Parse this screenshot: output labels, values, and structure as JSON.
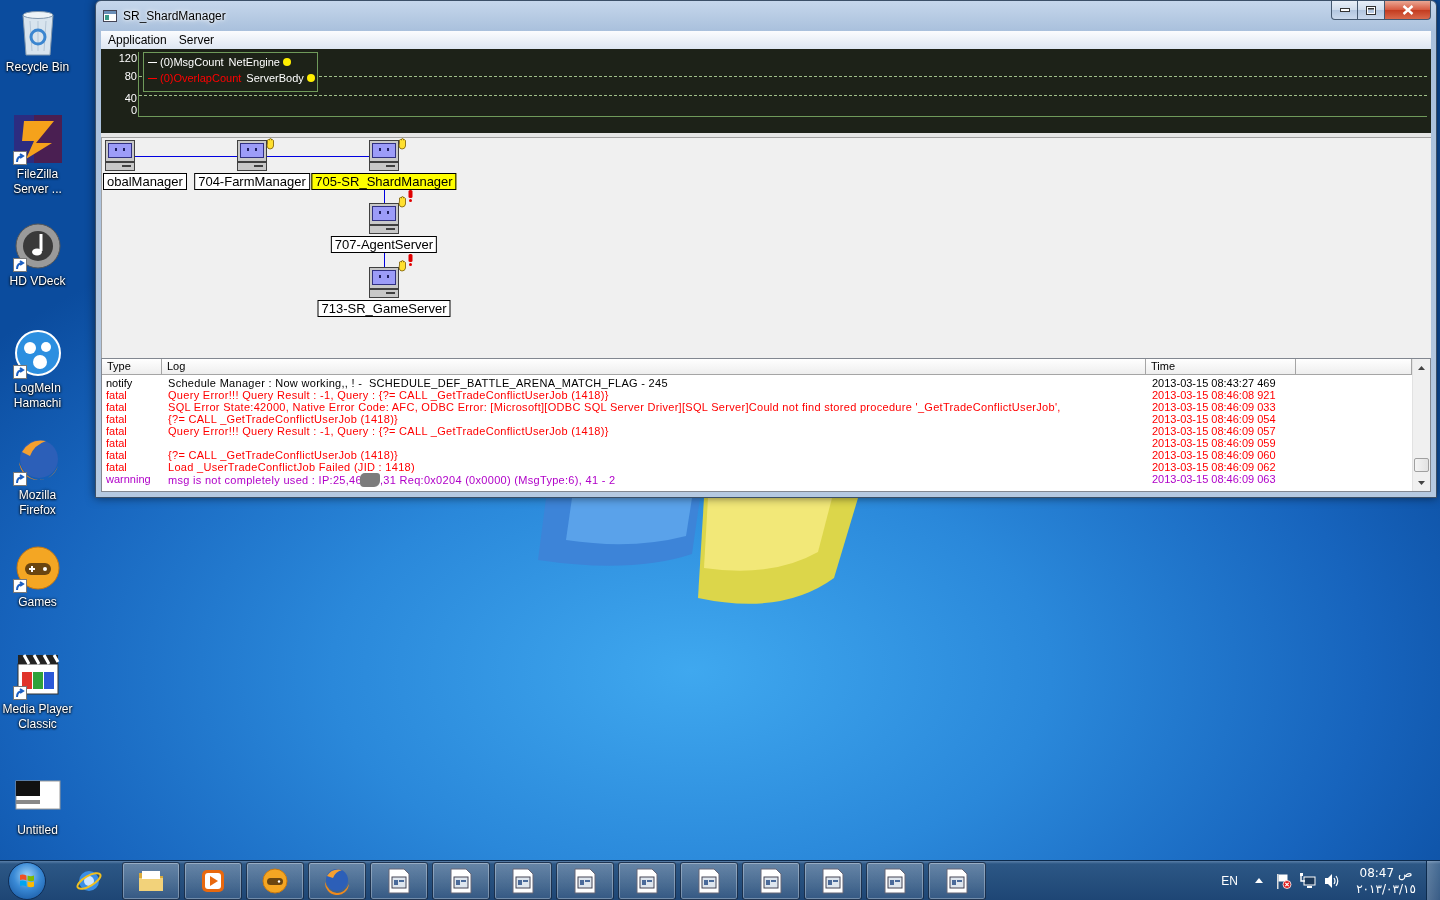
{
  "desktop_icons": [
    {
      "label": "Recycle Bin",
      "shortcut": false
    },
    {
      "label": "FileZilla Server ...",
      "shortcut": true
    },
    {
      "label": "HD VDeck",
      "shortcut": true
    },
    {
      "label": "LogMeIn Hamachi",
      "shortcut": true
    },
    {
      "label": "Mozilla Firefox",
      "shortcut": true
    },
    {
      "label": "Games",
      "shortcut": true
    },
    {
      "label": "Media Player Classic",
      "shortcut": true
    },
    {
      "label": "Untitled",
      "shortcut": false
    }
  ],
  "window": {
    "title": "SR_ShardManager",
    "menu": [
      "Application",
      "Server"
    ]
  },
  "monitor": {
    "y_labels": [
      "120",
      "80",
      "40",
      "0"
    ],
    "legend": [
      {
        "counter": "(0)MsgCount",
        "source": "NetEngine",
        "color": "#ffffff"
      },
      {
        "counter": "(0)OverlapCount",
        "source": "ServerBody",
        "color": "#ff0000"
      }
    ]
  },
  "topology": {
    "nodes": [
      {
        "label": "obalManager",
        "selected": false,
        "hand": false,
        "alert": false
      },
      {
        "label": "704-FarmManager",
        "selected": false,
        "hand": true,
        "alert": false
      },
      {
        "label": "705-SR_ShardManager",
        "selected": true,
        "hand": true,
        "alert": false
      },
      {
        "label": "707-AgentServer",
        "selected": false,
        "hand": true,
        "alert": true
      },
      {
        "label": "713-SR_GameServer",
        "selected": false,
        "hand": true,
        "alert": true
      }
    ]
  },
  "log": {
    "columns": [
      "Type",
      "Log",
      "Time"
    ],
    "rows": [
      {
        "type": "notify",
        "log": "Schedule Manager : Now working,, ! -  SCHEDULE_DEF_BATTLE_ARENA_MATCH_FLAG - 245",
        "time": "2013-03-15 08:43:27 469",
        "color": "#000000",
        "redacted": false
      },
      {
        "type": "fatal",
        "log": "Query Error!!! Query Result : -1, Query : {?= CALL _GetTradeConflictUserJob (1418)}",
        "time": "2013-03-15 08:46:08 921",
        "color": "#ff0000",
        "redacted": false
      },
      {
        "type": "fatal",
        "log": "SQL Error State:42000, Native Error Code: AFC, ODBC Error: [Microsoft][ODBC SQL Server Driver][SQL Server]Could not find stored procedure '_GetTradeConflictUserJob',",
        "time": "2013-03-15 08:46:09 033",
        "color": "#ff0000",
        "redacted": false
      },
      {
        "type": "fatal",
        "log": "{?= CALL _GetTradeConflictUserJob (1418)}",
        "time": "2013-03-15 08:46:09 054",
        "color": "#ff0000",
        "redacted": false
      },
      {
        "type": "fatal",
        "log": "Query Error!!! Query Result : -1, Query : {?= CALL _GetTradeConflictUserJob (1418)}",
        "time": "2013-03-15 08:46:09 057",
        "color": "#ff0000",
        "redacted": false
      },
      {
        "type": "fatal",
        "time": "2013-03-15 08:46:09 059",
        "color": "#ff0000",
        "redacted": false
      },
      {
        "type": "fatal",
        "log": "{?= CALL _GetTradeConflictUserJob (1418)}",
        "time": "2013-03-15 08:46:09 060",
        "color": "#ff0000",
        "redacted": false
      },
      {
        "type": "fatal",
        "log": "Load _UserTradeConflictJob Failed (JID : 1418)",
        "time": "2013-03-15 08:46:09 062",
        "color": "#ff0000",
        "redacted": false
      },
      {
        "type": "warnning",
        "log": "msg is not completely used : IP:25,46",
        "log_continued": ",31 Req:0x0204 (0x0000) (MsgType:6), 41 - 2",
        "time": "2013-03-15 08:46:09 063",
        "color": "#b000c8",
        "redacted": true
      }
    ]
  },
  "taskbar": {
    "buttons": [
      {
        "running": false
      },
      {
        "running": true
      },
      {
        "running": true
      },
      {
        "running": true
      },
      {
        "running": true
      },
      {
        "running": true
      },
      {
        "running": true
      },
      {
        "running": true
      },
      {
        "running": true
      },
      {
        "running": true
      },
      {
        "running": true
      },
      {
        "running": true
      },
      {
        "running": true
      },
      {
        "running": true
      },
      {
        "running": true
      }
    ],
    "language": "EN",
    "clock": {
      "time": "08:47 ص",
      "date": "٢٠١٣/٠٣/١٥"
    }
  }
}
